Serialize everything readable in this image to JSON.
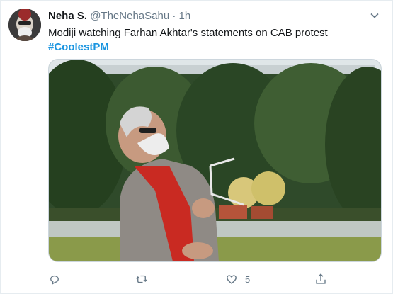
{
  "tweet": {
    "display_name": "Neha S.",
    "handle": "@TheNehaSahu",
    "separator": "·",
    "time": "1h",
    "text": "Modiji watching Farhan Akhtar's statements on CAB protest",
    "hashtag": "#CoolestPM"
  },
  "actions": {
    "reply_count": "",
    "retweet_count": "",
    "like_count": "5"
  },
  "icons": {
    "caret": "chevron-down-icon",
    "reply": "reply-icon",
    "retweet": "retweet-icon",
    "like": "heart-icon",
    "share": "share-icon"
  },
  "colors": {
    "link": "#1b95e0",
    "muted": "#657786",
    "text": "#14171a"
  }
}
